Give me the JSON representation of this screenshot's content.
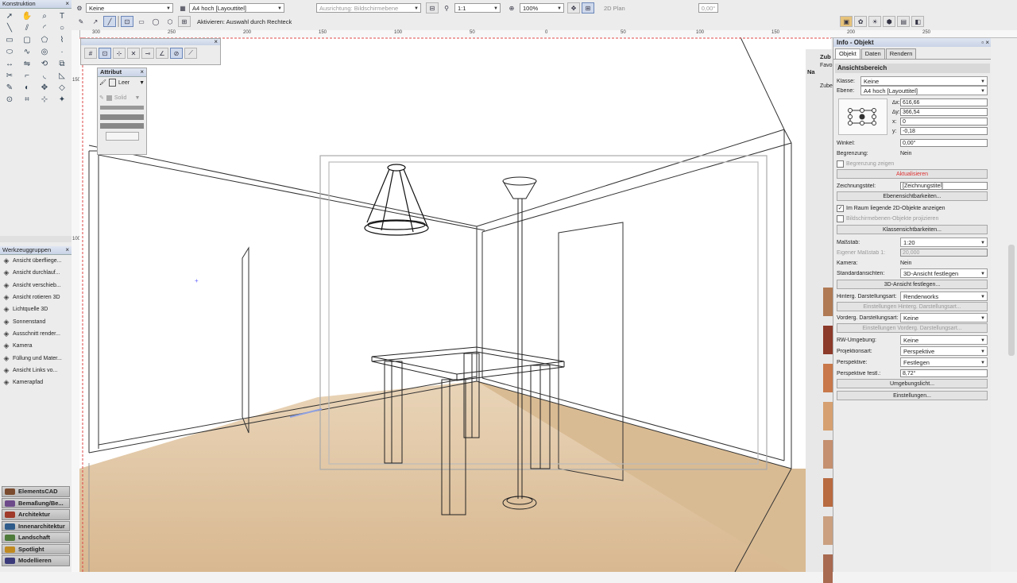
{
  "top": {
    "class_value": "Keine",
    "layer_value": "A4 hoch [Layouttitel]",
    "plane_value": "Ausrichtung: Bildschirmebene",
    "scale_value": "1:1",
    "zoom_value": "100%",
    "view_value": "2D Plan",
    "hint": "Aktivieren: Auswahl durch Rechteck",
    "angle_value": "0,00°"
  },
  "ruler": {
    "top_ticks": [
      "300",
      "250",
      "200",
      "150",
      "100",
      "50",
      "0",
      "50",
      "100",
      "150",
      "200",
      "250"
    ],
    "left_ticks": [
      "150",
      "100"
    ]
  },
  "left": {
    "konstruktion_title": "Konstruktion",
    "werkzeug_title": "Werkzeuggruppen",
    "werkzeug_items": [
      "Ansicht überfliege...",
      "Ansicht durchlauf...",
      "Ansicht verschieb...",
      "Ansicht rotieren 3D",
      "Lichtquelle 3D",
      "Sonnenstand",
      "Ausschnitt render...",
      "Kamera",
      "Füllung und Mater...",
      "Ansicht Links vo...",
      "Kamerapfad"
    ],
    "werkzeug_icons": [
      "eye-fly-icon",
      "walk-icon",
      "pan-icon",
      "rotate-icon",
      "light-icon",
      "sun-icon",
      "render-crop-icon",
      "camera-icon",
      "fill-icon",
      "view-left-icon",
      "camera-path-icon"
    ],
    "sets": [
      "ElementsCAD",
      "Bemaßung/Be...",
      "Architektur",
      "Innenarchitektur",
      "Landschaft",
      "Spotlight",
      "Modellieren"
    ],
    "set_colors": [
      "#7a4b2e",
      "#6d4a8a",
      "#a03a2a",
      "#2e5b8a",
      "#4e7b3a",
      "#c08a20",
      "#3a3a7a"
    ]
  },
  "attr": {
    "title": "Attribut",
    "fill_label": "Leer",
    "pen_label": "Solid"
  },
  "info": {
    "title": "Info - Objekt",
    "tabs": [
      "Objekt",
      "Daten",
      "Rendern"
    ],
    "section": "Ansichtsbereich",
    "klasse_label": "Klasse:",
    "klasse_value": "Keine",
    "ebene_label": "Ebene:",
    "ebene_value": "A4 hoch [Layouttitel]",
    "dx_label": "∆x:",
    "dx": "616,66",
    "dy_label": "∆y:",
    "dy": "366,54",
    "x_label": "x:",
    "x": "0",
    "y_label": "y:",
    "y": "-0,18",
    "winkel_label": "Winkel:",
    "winkel": "0,00°",
    "begrenzung_label": "Begrenzung:",
    "begrenzung": "Nein",
    "begrenzung_zeigen": "Begrenzung zeigen",
    "aktualisieren": "Aktualisieren",
    "zeichnungstitel_label": "Zeichnungstitel:",
    "zeichnungstitel": "[Zeichnungstitel]",
    "ebenensicht": "Ebenensichtbarkeiten...",
    "im_raum": "Im Raum liegende 2D-Objekte anzeigen",
    "bildschirmebenen": "Bildschirmebenen-Objekte projizieren",
    "klassensicht": "Klassensichtbarkeiten...",
    "massstab_label": "Maßstab:",
    "massstab": "1:20",
    "eigener_label": "Eigener Maßstab 1:",
    "eigener": "20,000",
    "kamera_label": "Kamera:",
    "kamera": "Nein",
    "standard_label": "Standardansichten:",
    "standard": "3D-Ansicht festlegen",
    "ansicht3d": "3D-Ansicht festlegen...",
    "hinterg_label": "Hinterg. Darstellungsart:",
    "hinterg": "Renderworks",
    "einst_hinterg": "Einstellungen Hinterg. Darstellungsart...",
    "vorderg_label": "Vorderg. Darstellungsart:",
    "vorderg": "Keine",
    "einst_vorderg": "Einstellungen Vorderg. Darstellungsart...",
    "rw_label": "RW-Umgebung:",
    "rw": "Keine",
    "proj_label": "Projektionsart:",
    "proj": "Perspektive",
    "persp_label": "Perspektive:",
    "persp": "Festlegen",
    "perspf_label": "Perspektive festl.:",
    "perspf": "8,72°",
    "umgebungslicht": "Umgebungslicht...",
    "einstellungen": "Einstellungen..."
  },
  "behind": {
    "a": "Zub",
    "b": "Favo",
    "c": "Zube",
    "d": "Na"
  }
}
